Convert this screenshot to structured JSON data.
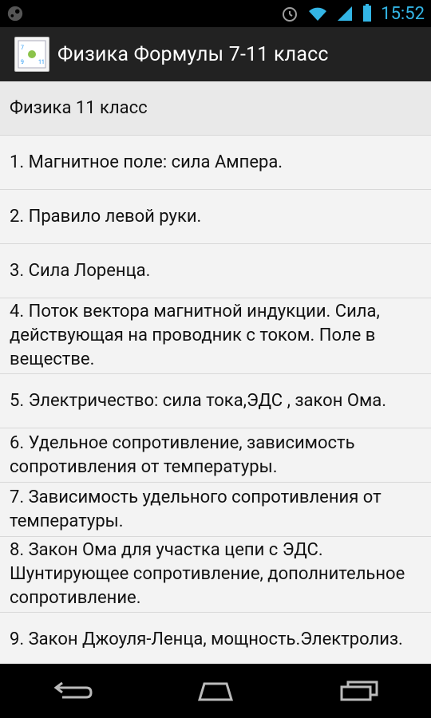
{
  "status": {
    "time": "15:52"
  },
  "app": {
    "title": "Физика Формулы 7-11 класс"
  },
  "list": {
    "header": "Физика 11 класс",
    "items": [
      "1. Магнитное поле: сила Ампера.",
      "2. Правило левой руки.",
      "3. Сила Лоренца.",
      "4. Поток вектора магнитной индукции. Сила, действующая на проводник с током. Поле в веществе.",
      "5. Электричество: сила тока,ЭДС , закон Ома.",
      "6. Удельное сопротивление, зависимость сопротивления от температуры.",
      "7. Зависимость удельного сопротивления от температуры.",
      "8. Закон Ома для участка цепи с ЭДС. Шунтирующее сопротивление, дополнительное сопротивление.",
      "9. Закон Джоуля-Ленца, мощность.Электролиз."
    ]
  },
  "nav": {
    "back": "back-icon",
    "home": "home-icon",
    "recents": "recents-icon"
  }
}
